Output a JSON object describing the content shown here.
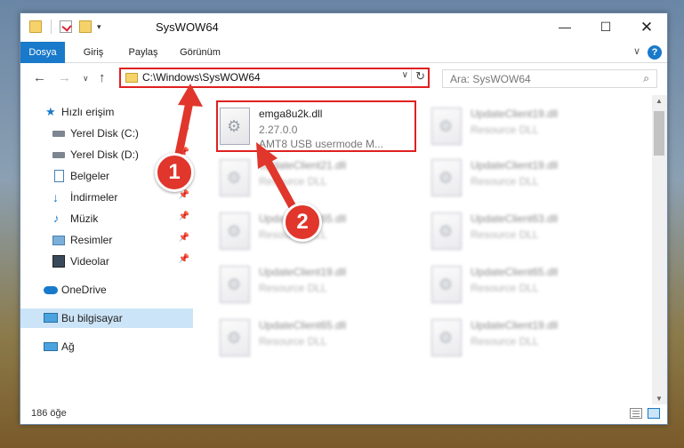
{
  "window": {
    "title": "SysWOW64",
    "controls": {
      "minimize": "—",
      "maximize": "☐",
      "close": "✕"
    }
  },
  "quick_access_toolbar": {
    "more_icon": "▾"
  },
  "ribbon": {
    "tabs": [
      "Dosya",
      "Giriş",
      "Paylaş",
      "Görünüm"
    ],
    "chevron": "∨",
    "help": "?"
  },
  "navigation": {
    "back": "←",
    "forward": "→",
    "recent": "∨",
    "up": "↑",
    "address": "C:\\Windows\\SysWOW64",
    "address_dropdown": "∨",
    "refresh": "↻",
    "search_placeholder": "Ara: SysWOW64",
    "search_icon": "⌕"
  },
  "sidebar": {
    "items": [
      {
        "label": "Hızlı erişim",
        "icon": "star-icon",
        "pinned": false
      },
      {
        "label": "Yerel Disk (C:)",
        "icon": "drive-icon",
        "pinned": true
      },
      {
        "label": "Yerel Disk (D:)",
        "icon": "drive-icon",
        "pinned": true
      },
      {
        "label": "Belgeler",
        "icon": "documents-icon",
        "pinned": true
      },
      {
        "label": "İndirmeler",
        "icon": "download-icon",
        "pinned": true
      },
      {
        "label": "Müzik",
        "icon": "music-icon",
        "pinned": true
      },
      {
        "label": "Resimler",
        "icon": "pictures-icon",
        "pinned": true
      },
      {
        "label": "Videolar",
        "icon": "video-icon",
        "pinned": true
      },
      {
        "label": "OneDrive",
        "icon": "cloud-icon",
        "pinned": false
      },
      {
        "label": "Bu bilgisayar",
        "icon": "computer-icon",
        "pinned": false
      },
      {
        "label": "Ağ",
        "icon": "network-icon",
        "pinned": false
      }
    ],
    "pin_glyph": "📌",
    "selected": "Bu bilgisayar"
  },
  "files": [
    {
      "name": "emga8u2k.dll",
      "version": "2.27.0.0",
      "desc": "AMT8 USB usermode M...",
      "highlighted": true
    },
    {
      "name": "UpdateClient19.dll",
      "version": "Resource DLL",
      "desc": ""
    },
    {
      "name": "UpdateClient21.dll",
      "version": "Resource DLL",
      "desc": ""
    },
    {
      "name": "UpdateClient19.dll",
      "version": "Resource DLL",
      "desc": ""
    },
    {
      "name": "UpdateClient65.dll",
      "version": "Resource DLL",
      "desc": ""
    },
    {
      "name": "UpdateClient63.dll",
      "version": "Resource DLL",
      "desc": ""
    },
    {
      "name": "UpdateClient19.dll",
      "version": "Resource DLL",
      "desc": ""
    },
    {
      "name": "UpdateClient65.dll",
      "version": "Resource DLL",
      "desc": ""
    },
    {
      "name": "UpdateClient65.dll",
      "version": "Resource DLL",
      "desc": ""
    },
    {
      "name": "UpdateClient19.dll",
      "version": "Resource DLL",
      "desc": ""
    }
  ],
  "status": {
    "item_count": "186 öğe"
  },
  "annotations": {
    "badge_1": "1",
    "badge_2": "2",
    "color": "#e0362c"
  }
}
